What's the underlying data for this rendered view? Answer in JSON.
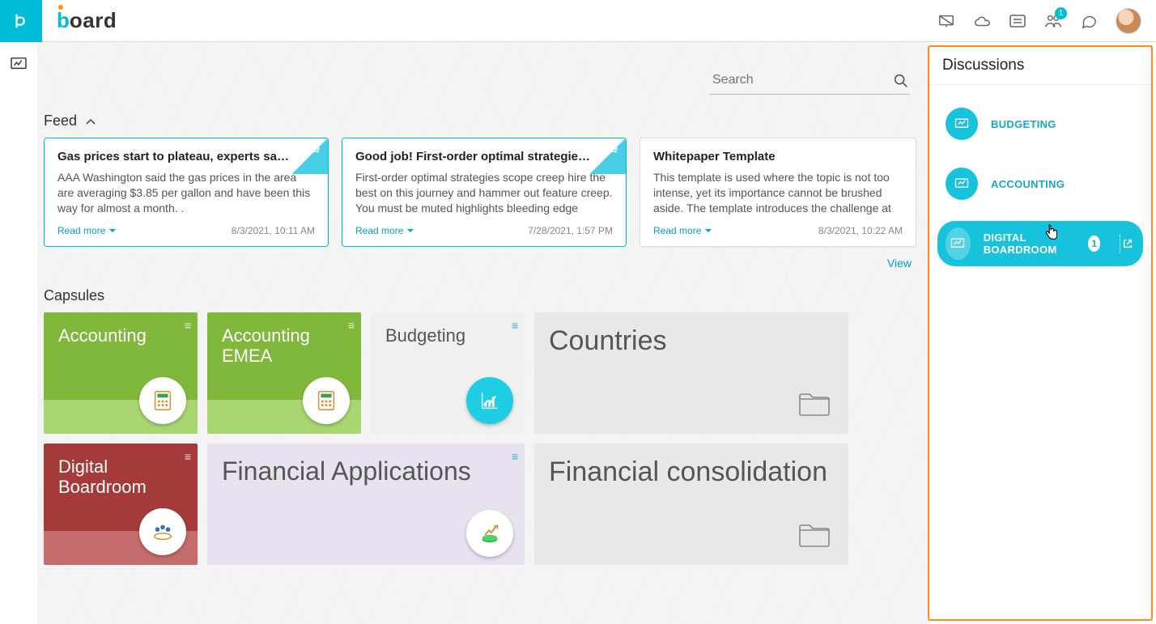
{
  "brand": {
    "b": "b",
    "rest": "oard"
  },
  "topIcons": {
    "presentationBadge": "",
    "peopleBadge": "1",
    "chatBadge": ""
  },
  "search": {
    "placeholder": "Search"
  },
  "sections": {
    "feedTitle": "Feed",
    "capsulesTitle": "Capsules",
    "viewLink": "View"
  },
  "feed": [
    {
      "title": "Gas prices start to plateau, experts say drop s…",
      "body": "AAA Washington said the gas prices in the area are averaging $3.85 per gallon and have been this way for almost a month.          .",
      "readmore": "Read more",
      "timestamp": "8/3/2021, 10:11 AM",
      "announce": true
    },
    {
      "title": "Good job! First-order optimal strategies scope …",
      "body": "First-order optimal strategies scope creep hire the best on this journey and hammer out feature creep. You must be muted highlights bleeding edge hammer out,…",
      "readmore": "Read more",
      "timestamp": "7/28/2021, 1:57 PM",
      "announce": true
    },
    {
      "title": "Whitepaper Template",
      "body": "This template is used where the topic is not too intense, yet its importance cannot be brushed aside. The template introduces the challenge at hand, break…",
      "readmore": "Read more",
      "timestamp": "8/3/2021, 10:22 AM",
      "announce": false
    }
  ],
  "capsules": {
    "row1": [
      {
        "title": "Accounting"
      },
      {
        "title": "Accounting EMEA"
      },
      {
        "title": "Budgeting"
      },
      {
        "title": "Countries"
      }
    ],
    "row2": [
      {
        "title": "Digital Boardroom"
      },
      {
        "title": "Financial Applications"
      },
      {
        "title": "Financial consolidation"
      }
    ]
  },
  "discussions": {
    "title": "Discussions",
    "items": [
      {
        "label": "BUDGETING",
        "active": false
      },
      {
        "label": "ACCOUNTING",
        "active": false
      },
      {
        "label": "DIGITAL BOARDROOM",
        "active": true,
        "count": "1"
      }
    ]
  }
}
